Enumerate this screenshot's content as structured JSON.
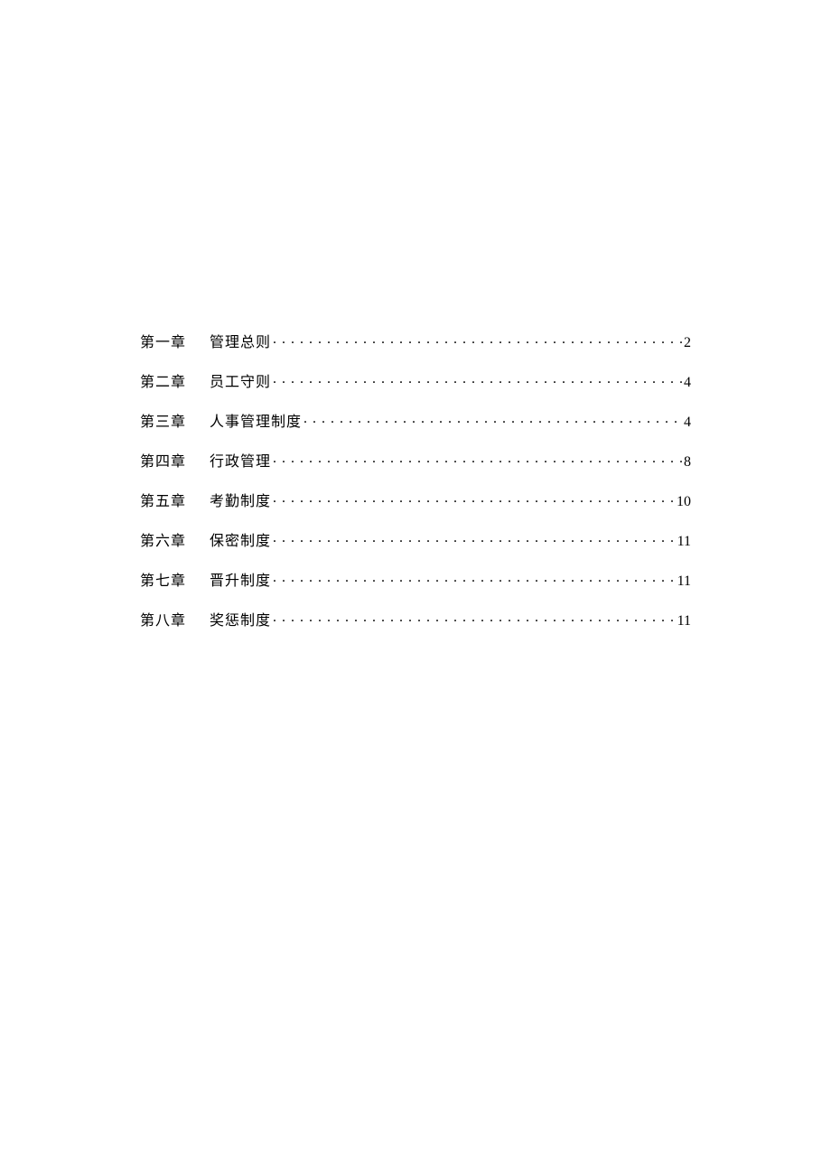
{
  "toc": [
    {
      "chapter": "第一章",
      "title": "管理总则",
      "page": "2"
    },
    {
      "chapter": "第二章",
      "title": "员工守则",
      "page": "4"
    },
    {
      "chapter": "第三章",
      "title": "人事管理制度",
      "page": "4"
    },
    {
      "chapter": "第四章",
      "title": "行政管理",
      "page": "8"
    },
    {
      "chapter": "第五章",
      "title": "考勤制度",
      "page": "10"
    },
    {
      "chapter": "第六章",
      "title": "保密制度",
      "page": "11"
    },
    {
      "chapter": "第七章",
      "title": "晋升制度",
      "page": "11"
    },
    {
      "chapter": "第八章",
      "title": "奖惩制度",
      "page": "11"
    }
  ]
}
